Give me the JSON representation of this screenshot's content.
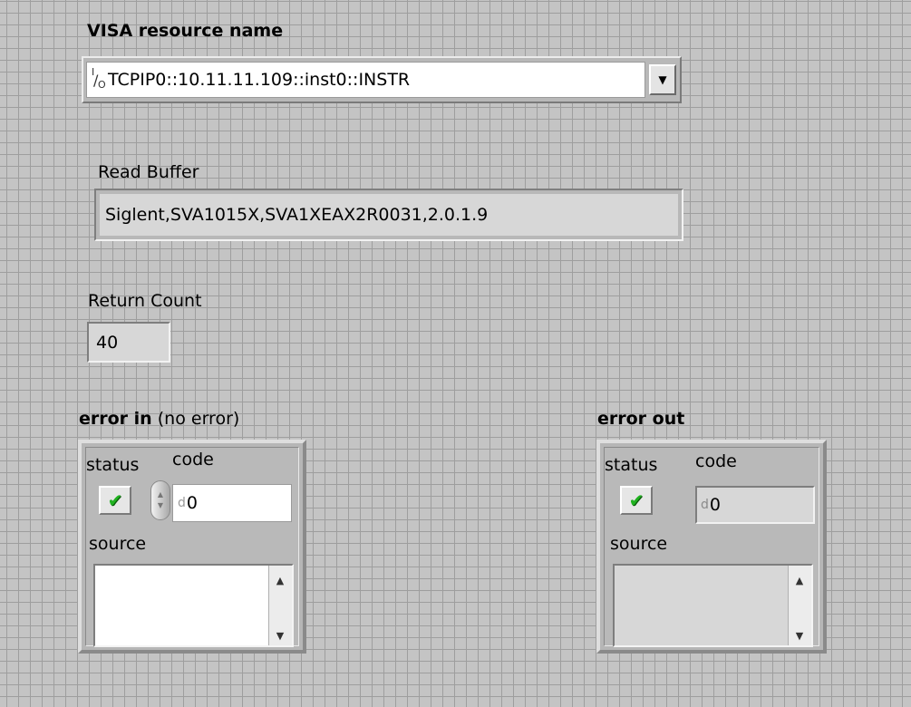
{
  "visa": {
    "label": "VISA resource name",
    "io_glyph_top": "I",
    "io_glyph_slash": "/",
    "io_glyph_bottom": "O",
    "value": "TCPIP0::10.11.11.109::inst0::INSTR",
    "dropdown_glyph": "▼"
  },
  "read_buffer": {
    "label": "Read Buffer",
    "value": "Siglent,SVA1015X,SVA1XEAX2R0031,2.0.1.9"
  },
  "return_count": {
    "label": "Return Count",
    "value": "40"
  },
  "error_in": {
    "label_bold": "error in",
    "label_suffix": "(no error)",
    "status_label": "status",
    "code_label": "code",
    "code_radix": "d",
    "code_value": "0",
    "source_label": "source",
    "source_value": "",
    "status_check": "✔",
    "spinner_up": "▲",
    "spinner_down": "▼",
    "scroll_up": "▲",
    "scroll_down": "▼"
  },
  "error_out": {
    "label_bold": "error out",
    "status_label": "status",
    "code_label": "code",
    "code_radix": "d",
    "code_value": "0",
    "source_label": "source",
    "source_value": "",
    "status_check": "✔",
    "scroll_up": "▲",
    "scroll_down": "▼"
  },
  "colors": {
    "panel_bg": "#c4c4c4",
    "grid_line": "#9e9e9e",
    "check_green": "#1fb21f",
    "indicator_bg": "#d7d7d7",
    "control_bg": "#ffffff"
  }
}
